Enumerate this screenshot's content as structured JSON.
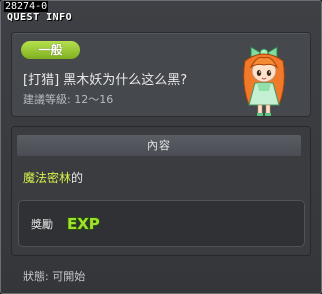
{
  "quest_id": "28274-0",
  "window": {
    "title": "QUEST INFO"
  },
  "header": {
    "category": "一般",
    "quest_name": "[打猎] 黑木妖为什么这么黑?",
    "level_label": "建議等級",
    "level_sep": ": ",
    "level_range": "12～16"
  },
  "content": {
    "section_title": "內容",
    "text_highlight": "魔法密林",
    "text_suffix": "的"
  },
  "reward": {
    "label": "獎勵",
    "icon": "exp-icon",
    "icon_text": "EXP"
  },
  "status": {
    "label": "狀態",
    "sep": ": ",
    "value": "可開始"
  },
  "colors": {
    "category_pill": "#9ccc3a",
    "highlight_text": "#d7f04a",
    "exp_icon": "#9ee22c",
    "background": "#3e4045"
  }
}
